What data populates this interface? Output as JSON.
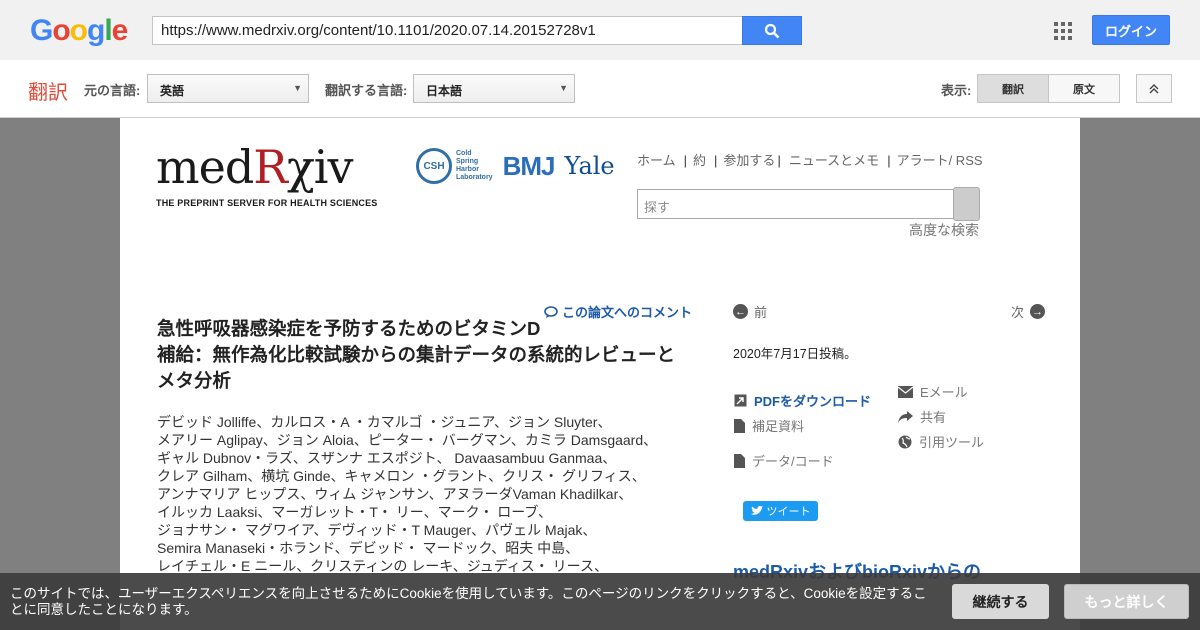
{
  "google_bar": {
    "logo_letters": [
      {
        "ch": "G",
        "color": "#4285f4"
      },
      {
        "ch": "o",
        "color": "#ea4335"
      },
      {
        "ch": "o",
        "color": "#fbbc05"
      },
      {
        "ch": "g",
        "color": "#4285f4"
      },
      {
        "ch": "l",
        "color": "#34a853"
      },
      {
        "ch": "e",
        "color": "#ea4335"
      }
    ],
    "url": "https://www.medrxiv.org/content/10.1101/2020.07.14.20152728v1",
    "search_icon": "search-icon",
    "apps_icon": "apps-grid-icon",
    "login_label": "ログイン"
  },
  "translate_bar": {
    "logo": "翻訳",
    "source_label": "元の言語:",
    "source_value": "英語",
    "target_label": "翻訳する言語:",
    "target_value": "日本語",
    "view_label": "表示:",
    "view_translated": "翻訳",
    "view_original": "原文",
    "collapse_icon": "chevron-up-icon"
  },
  "site": {
    "wordmark_pre": "med",
    "wordmark_r": "R",
    "wordmark_post": "χiv",
    "tagline": "THE PREPRINT SERVER FOR HEALTH SCIENCES",
    "csh_abbr": "CSH",
    "csh_text": [
      "Cold",
      "Spring",
      "Harbor",
      "Laboratory"
    ],
    "bmj": "BMJ",
    "yale": "Yale",
    "nav": [
      "ホーム",
      "約",
      "参加する",
      "ニュースとメモ",
      "アラート/ RSS"
    ],
    "search_placeholder": "探す",
    "advanced_search": "高度な検索"
  },
  "article": {
    "comment_link": "この論文へのコメント",
    "title": "急性呼吸器感染症を予防するためのビタミンD補給：無作為化比較試験からの集計データの系統的レビューとメタ分析",
    "title_lines": [
      "急性呼吸器感染症を予防するためのビタミンD",
      "補給：無作為化比較試験からの集計データの系統的レビューと",
      "メタ分析"
    ],
    "author_lines": [
      "デビッド Jolliffe、カルロス・A ・カマルゴ ・ジュニア、ジョン Sluyter、",
      "メアリー Aglipay、ジョン Aloia、ピーター・ バーグマン、カミラ Damsgaard、",
      "ギャル Dubnov・ラズ、スザンナ エスポジト、 Davaasambuu Ganmaa、",
      "クレア Gilham、横坑 Ginde、キャメロン ・グラント、クリス・ グリフィス、",
      "アンナマリア ヒップス、ウィム ジャンサン、アヌラーダVaman Khadilkar、",
      "イルッカ Laaksi、マーガレット・T・ リー、マーク・ ローブ、",
      "ジョナサン・ マグワイア、デヴィッド・T Mauger、パヴェル Majak、",
      "Semira Manaseki・ホランド、デビッド・ マードック、昭夫 中島、",
      "レイチェル・E ニール、クリスティンの レーキ、ジュディス・ リース、"
    ]
  },
  "sidebar": {
    "prev": "前",
    "next": "次",
    "posted": "2020年7月17日投稿。",
    "download_pdf": "PDFをダウンロード",
    "supplementary": "補足資料",
    "data_code": "データ/コード",
    "email": "Eメール",
    "share": "共有",
    "cite": "引用ツール",
    "tweet": "ツイート",
    "bottom_heading": "medRxivおよびbioRxivからの"
  },
  "cookie": {
    "text": "このサイトでは、ユーザーエクスペリエンスを向上させるためにCookieを使用しています。このページのリンクをクリックすると、Cookieを設定することに同意したことになります。",
    "continue_label": "継続する",
    "more_label": "もっと詳しく"
  }
}
